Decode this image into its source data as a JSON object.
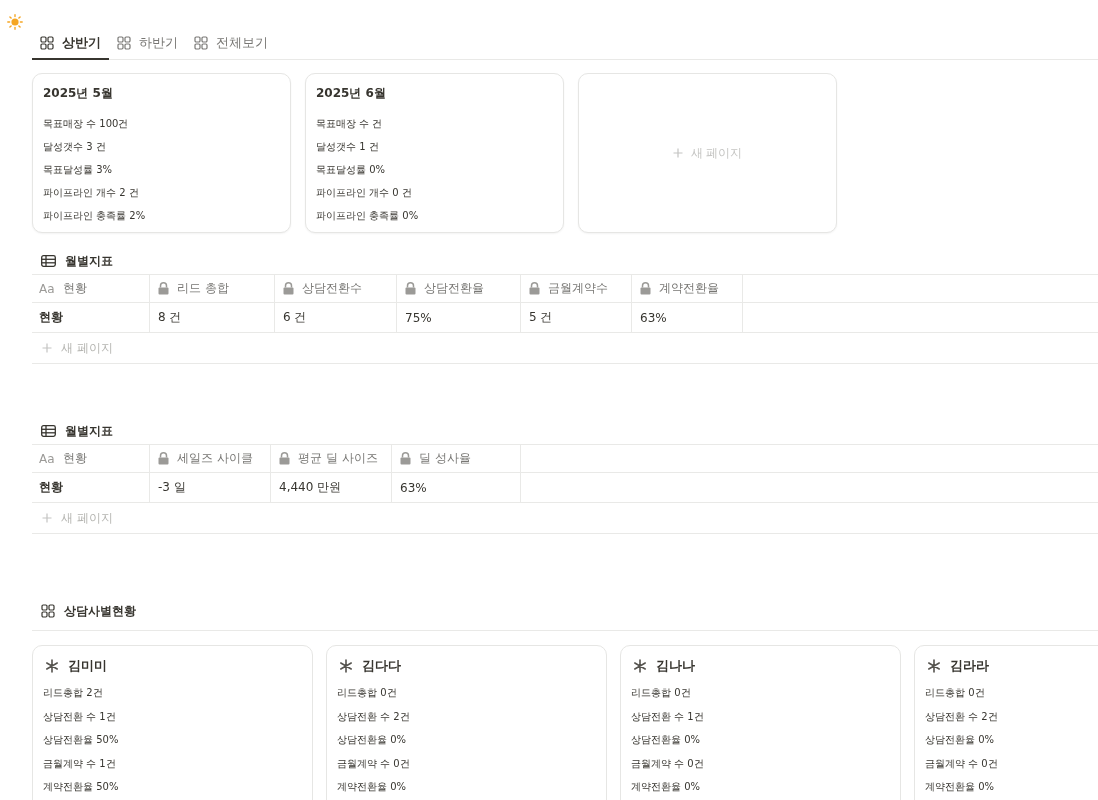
{
  "tabs": [
    {
      "label": "상반기",
      "selected": true
    },
    {
      "label": "하반기",
      "selected": false
    },
    {
      "label": "전체보기",
      "selected": false
    }
  ],
  "gallery": {
    "cards": [
      {
        "title": "2025년 5월",
        "lines": [
          "목표매장 수 100건",
          "달성갯수 3 건",
          "목표달성률 3%",
          "파이프라인 개수 2 건",
          "파이프라인 충족률 2%"
        ]
      },
      {
        "title": "2025년 6월",
        "lines": [
          "목표매장 수 건",
          "달성갯수 1 건",
          "목표달성률 0%",
          "파이프라인 개수 0 건",
          "파이프라인 충족률 0%"
        ]
      }
    ],
    "new_page": "새 페이지"
  },
  "tables": [
    {
      "title": "월별지표",
      "columns": [
        {
          "label": "현황",
          "kind": "title",
          "type_label": "Aa"
        },
        {
          "label": "리드 총합",
          "kind": "formula"
        },
        {
          "label": "상담전환수",
          "kind": "formula"
        },
        {
          "label": "상담전환율",
          "kind": "formula"
        },
        {
          "label": "금월계약수",
          "kind": "formula"
        },
        {
          "label": "계약전환율",
          "kind": "formula"
        }
      ],
      "rows": [
        [
          "현황",
          "8 건",
          "6 건",
          "75%",
          "5 건",
          "63%"
        ]
      ],
      "new_page": "새 페이지"
    },
    {
      "title": "월별지표",
      "columns": [
        {
          "label": "현황",
          "kind": "title",
          "type_label": "Aa"
        },
        {
          "label": "세일즈 사이클",
          "kind": "formula"
        },
        {
          "label": "평균 딜 사이즈",
          "kind": "formula"
        },
        {
          "label": "딜 성사율",
          "kind": "formula"
        }
      ],
      "rows": [
        [
          "현황",
          "-3 일",
          "4,440 만원",
          "63%"
        ]
      ],
      "new_page": "새 페이지"
    }
  ],
  "consultants": {
    "title": "상담사별현황",
    "cards": [
      {
        "name": "김미미",
        "lines": [
          "리드총합 2건",
          "상담전환 수 1건",
          "상담전환율 50%",
          "금월계약 수 1건",
          "계약전환율 50%"
        ]
      },
      {
        "name": "김다다",
        "lines": [
          "리드총합 0건",
          "상담전환 수 2건",
          "상담전환율 0%",
          "금월계약 수 0건",
          "계약전환율 0%"
        ]
      },
      {
        "name": "김나나",
        "lines": [
          "리드총합 0건",
          "상담전환 수 1건",
          "상담전환율 0%",
          "금월계약 수 0건",
          "계약전환율 0%"
        ]
      },
      {
        "name": "김라라",
        "lines": [
          "리드총합 0건",
          "상담전환 수 2건",
          "상담전환율 0%",
          "금월계약 수 0건",
          "계약전환율 0%"
        ]
      }
    ]
  }
}
